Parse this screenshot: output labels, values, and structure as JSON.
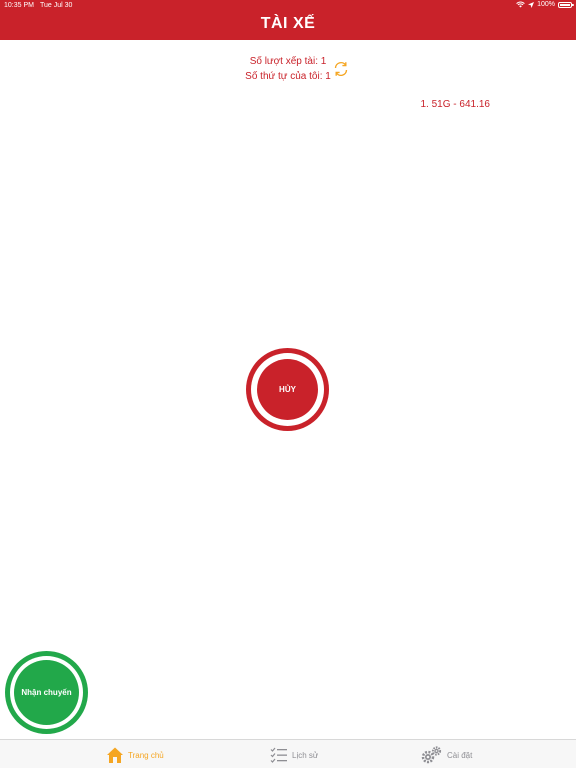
{
  "status_bar": {
    "time": "10:35 PM",
    "date": "Tue Jul 30",
    "battery": "100%",
    "battery_level": 1.0
  },
  "header": {
    "title": "TÀI XẾ"
  },
  "info": {
    "turn_count": "Số lượt xếp tài: 1",
    "my_position": "Số thứ tự của tôi: 1"
  },
  "vehicle": {
    "entry": "1. 51G - 641.16"
  },
  "cancel_button": {
    "label": "HỦY"
  },
  "accept_button": {
    "label": "Nhận chuyến"
  },
  "tabs": [
    {
      "label": "Trang chủ",
      "icon": "home-icon",
      "active": true
    },
    {
      "label": "Lịch sử",
      "icon": "checklist-icon",
      "active": false
    },
    {
      "label": "Cài đặt",
      "icon": "gears-icon",
      "active": false
    }
  ],
  "colors": {
    "primary": "#c9222a",
    "accept": "#22a84a",
    "active_tab": "#f5a623",
    "refresh_icon": "#f5a623",
    "inactive_tab": "#8e8e93"
  }
}
